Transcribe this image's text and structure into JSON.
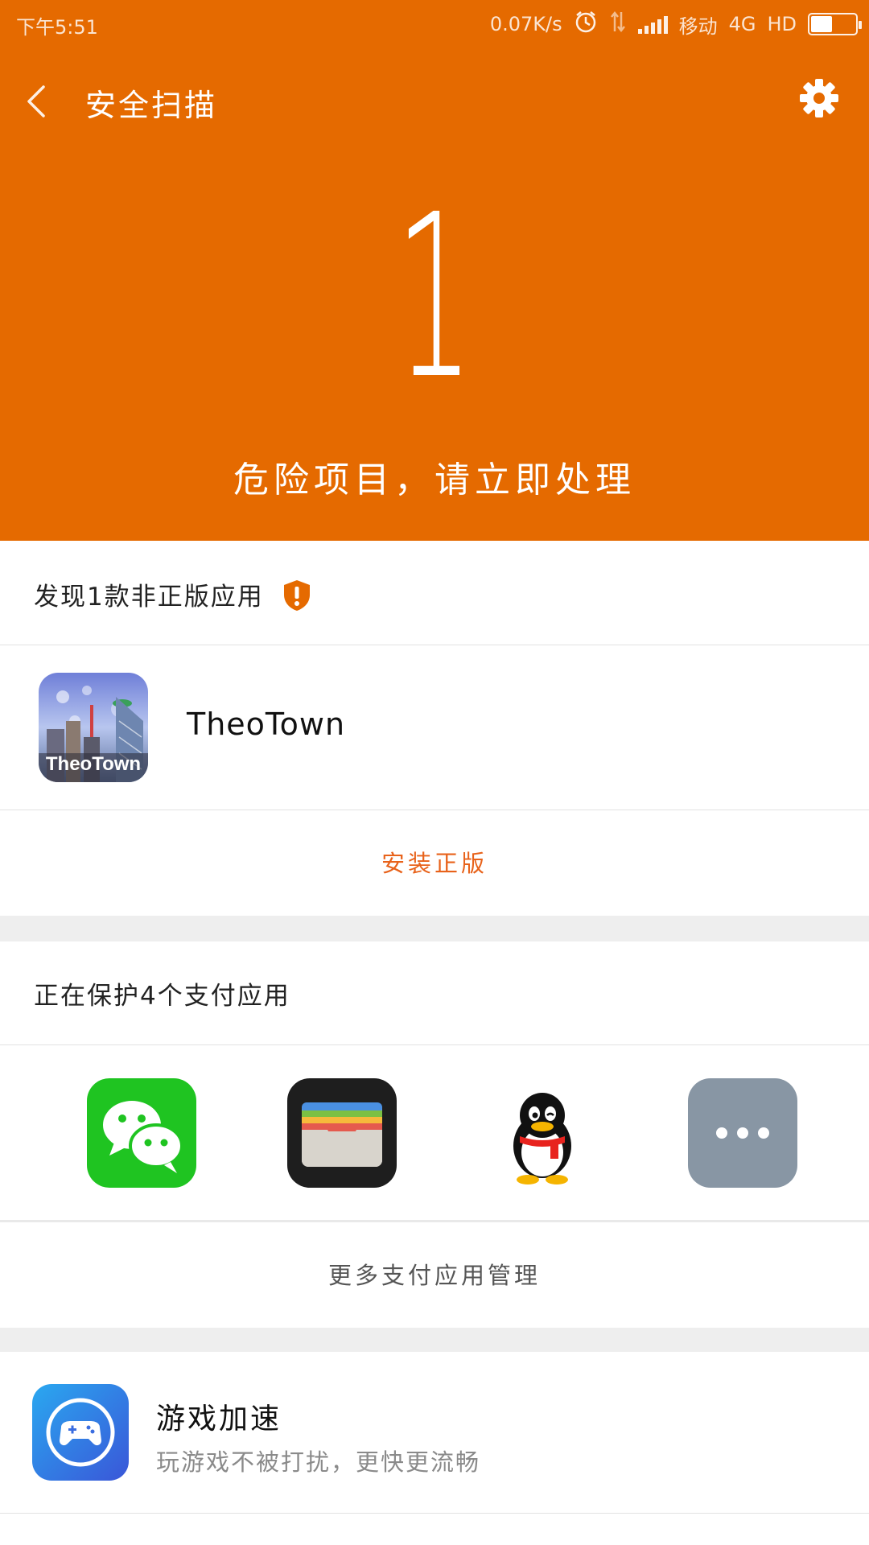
{
  "status_bar": {
    "time": "下午5:51",
    "speed": "0.07K/s",
    "carrier": "移动",
    "network": "4G",
    "hd": "HD",
    "battery_level": 0.45
  },
  "header": {
    "title": "安全扫描",
    "count": "1",
    "message": "危险项目，请立即处理",
    "background_color": "#e56a00"
  },
  "pirated_section": {
    "title": "发现1款非正版应用",
    "warning_icon": "shield-alert-icon",
    "apps": [
      {
        "name": "TheoTown",
        "icon_label": "TheoTown"
      }
    ],
    "action_label": "安装正版",
    "action_color": "#e8621a"
  },
  "payment_section": {
    "title": "正在保护4个支付应用",
    "apps": [
      {
        "icon": "wechat-icon"
      },
      {
        "icon": "wallet-icon"
      },
      {
        "icon": "qq-penguin-icon"
      },
      {
        "icon": "more-apps-icon"
      }
    ],
    "manage_label": "更多支付应用管理"
  },
  "feature": {
    "title": "游戏加速",
    "subtitle": "玩游戏不被打扰，更快更流畅",
    "icon": "gamepad-icon"
  }
}
